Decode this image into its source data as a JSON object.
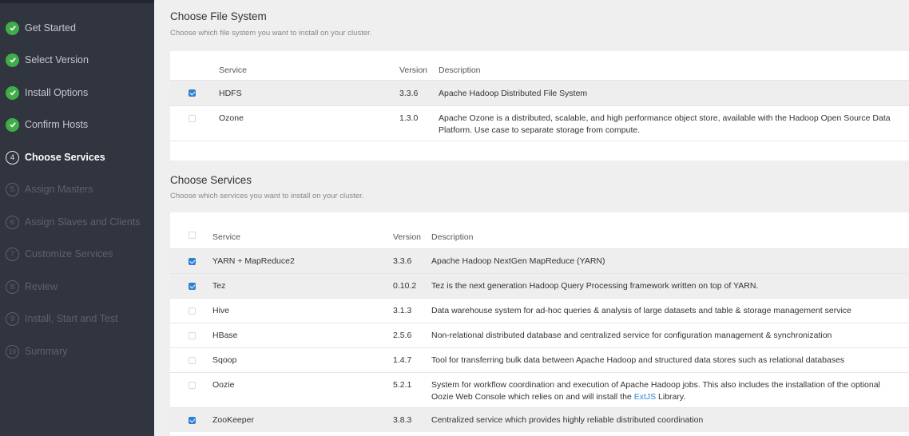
{
  "sidebar": {
    "steps": [
      {
        "label": "Get Started",
        "state": "done",
        "num": "1"
      },
      {
        "label": "Select Version",
        "state": "done",
        "num": "2"
      },
      {
        "label": "Install Options",
        "state": "done",
        "num": "3"
      },
      {
        "label": "Confirm Hosts",
        "state": "done",
        "num": "3"
      },
      {
        "label": "Choose Services",
        "state": "current",
        "num": "4"
      },
      {
        "label": "Assign Masters",
        "state": "pending",
        "num": "5"
      },
      {
        "label": "Assign Slaves and Clients",
        "state": "pending",
        "num": "6"
      },
      {
        "label": "Customize Services",
        "state": "pending",
        "num": "7"
      },
      {
        "label": "Review",
        "state": "pending",
        "num": "8"
      },
      {
        "label": "Install, Start and Test",
        "state": "pending",
        "num": "9"
      },
      {
        "label": "Summary",
        "state": "pending",
        "num": "10"
      }
    ]
  },
  "filesystem": {
    "title": "Choose File System",
    "subtitle": "Choose which file system you want to install on your cluster.",
    "columns": {
      "service": "Service",
      "version": "Version",
      "description": "Description"
    },
    "rows": [
      {
        "checked": true,
        "service": "HDFS",
        "version": "3.3.6",
        "description": "Apache Hadoop Distributed File System"
      },
      {
        "checked": false,
        "service": "Ozone",
        "version": "1.3.0",
        "description": "Apache Ozone is a distributed, scalable, and high performance object store, available with the Hadoop Open Source Data Platform. Use case to separate storage from compute."
      }
    ]
  },
  "services": {
    "title": "Choose Services",
    "subtitle": "Choose which services you want to install on your cluster.",
    "columns": {
      "service": "Service",
      "version": "Version",
      "description": "Description"
    },
    "rows": [
      {
        "checked": true,
        "service": "YARN + MapReduce2",
        "version": "3.3.6",
        "description": "Apache Hadoop NextGen MapReduce (YARN)"
      },
      {
        "checked": true,
        "service": "Tez",
        "version": "0.10.2",
        "description": "Tez is the next generation Hadoop Query Processing framework written on top of YARN."
      },
      {
        "checked": false,
        "service": "Hive",
        "version": "3.1.3",
        "description": "Data warehouse system for ad-hoc queries & analysis of large datasets and table & storage management service"
      },
      {
        "checked": false,
        "service": "HBase",
        "version": "2.5.6",
        "description": "Non-relational distributed database and centralized service for configuration management & synchronization"
      },
      {
        "checked": false,
        "service": "Sqoop",
        "version": "1.4.7",
        "description": "Tool for transferring bulk data between Apache Hadoop and structured data stores such as relational databases"
      },
      {
        "checked": false,
        "service": "Oozie",
        "version": "5.2.1",
        "description_before": "System for workflow coordination and execution of Apache Hadoop jobs. This also includes the installation of the optional Oozie Web Console which relies on and will install the ",
        "description_link": "ExtJS",
        "description_after": " Library."
      },
      {
        "checked": true,
        "service": "ZooKeeper",
        "version": "3.8.3",
        "description": "Centralized service which provides highly reliable distributed coordination"
      }
    ]
  },
  "colors": {
    "sidebar_bg": "#303540",
    "done_green": "#3fae49",
    "check_blue": "#2f7fd3",
    "link": "#2f88d6"
  }
}
